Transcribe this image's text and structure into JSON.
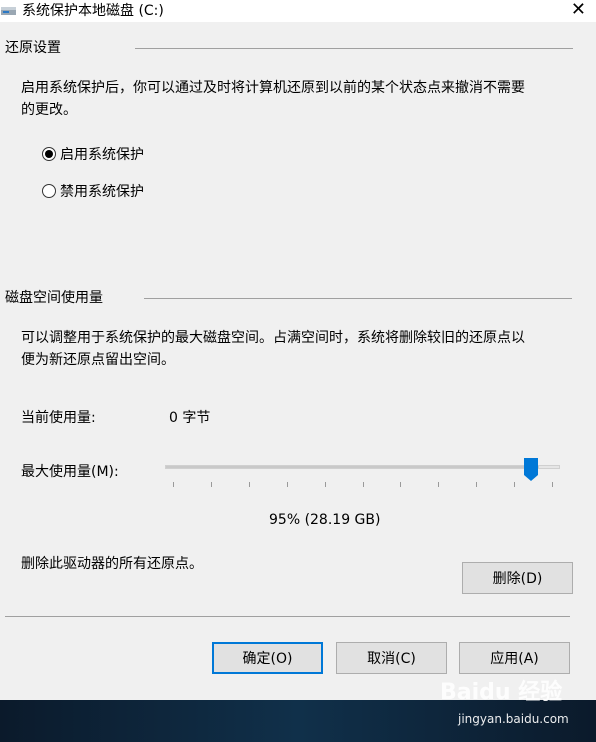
{
  "window": {
    "title": "系统保护本地磁盘 (C:)",
    "close_glyph": "✕"
  },
  "restore": {
    "heading": "还原设置",
    "description_line1": "启用系统保护后，你可以通过及时将计算机还原到以前的某个状态点来撤消不需要",
    "description_line2": "的更改。",
    "options": [
      {
        "label": "启用系统保护",
        "selected": true
      },
      {
        "label": "禁用系统保护",
        "selected": false
      }
    ]
  },
  "disk": {
    "heading": "磁盘空间使用量",
    "description_line1": "可以调整用于系统保护的最大磁盘空间。占满空间时，系统将删除较旧的还原点以",
    "description_line2": "便为新还原点留出空间。",
    "current_label": "当前使用量:",
    "current_value": "0 字节",
    "max_label": "最大使用量(M):",
    "slider_percent": 95,
    "max_value": "95% (28.19 GB)",
    "delete_text": "删除此驱动器的所有还原点。",
    "delete_button": "删除(D)"
  },
  "footer": {
    "ok": "确定(O)",
    "cancel": "取消(C)",
    "apply": "应用(A)"
  },
  "watermark": {
    "logo": "Baidu 经验",
    "url": "jingyan.baidu.com"
  },
  "colors": {
    "accent": "#0078d7",
    "taskbar": "#0f1c2e"
  }
}
